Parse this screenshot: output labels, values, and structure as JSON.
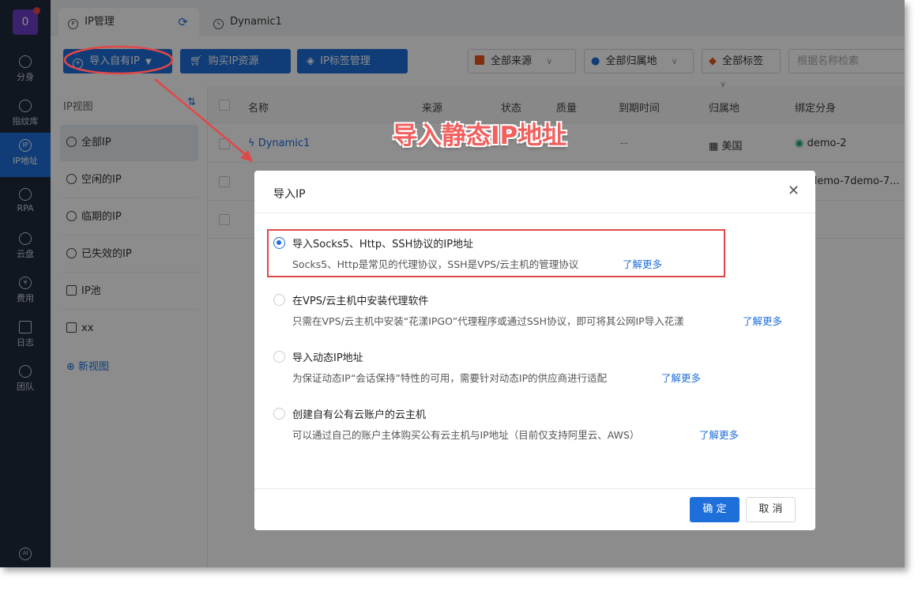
{
  "rail": {
    "avatar": "0",
    "items": [
      {
        "icon": "globe-icon",
        "label": "分身"
      },
      {
        "icon": "fingerprint-icon",
        "label": "指纹库"
      },
      {
        "icon": "ip-icon",
        "label": "IP地址"
      },
      {
        "icon": "robot-icon",
        "label": "RPA"
      },
      {
        "icon": "cloud-disk-icon",
        "label": "云盘"
      },
      {
        "icon": "yen-icon",
        "label": "费用"
      },
      {
        "icon": "log-icon",
        "label": "日志"
      },
      {
        "icon": "team-icon",
        "label": "团队"
      }
    ],
    "ai_label": "AI"
  },
  "tabs": [
    {
      "label": "IP管理"
    },
    {
      "label": "Dynamic1"
    }
  ],
  "toolbar": {
    "import_label": "导入自有IP",
    "buy_label": "购买IP资源",
    "tag_manage_label": "IP标签管理",
    "filters": [
      "全部来源",
      "全部归属地",
      "全部标签"
    ],
    "search_placeholder": "根据名称检索"
  },
  "sidenav": {
    "header": "IP视图",
    "items": [
      "全部IP",
      "空闲的IP",
      "临期的IP",
      "已失效的IP",
      "IP池",
      "xx"
    ],
    "new_view": "新视图"
  },
  "table": {
    "columns": [
      "名称",
      "来源",
      "状态",
      "质量",
      "到期时间",
      "归属地",
      "绑定分身"
    ],
    "rows": [
      {
        "name": "Dynamic1",
        "expire": "--",
        "location": "美国",
        "bound": "demo-2"
      },
      {
        "name": "",
        "expire": "",
        "location": "",
        "bound": "demo-7demo-7..."
      },
      {
        "name": "",
        "expire": "",
        "location": "",
        "bound": ""
      }
    ]
  },
  "modal": {
    "title": "导入IP",
    "options": [
      {
        "title": "导入Socks5、Http、SSH协议的IP地址",
        "desc": "Socks5、Http是常见的代理协议，SSH是VPS/云主机的管理协议",
        "learn": "了解更多",
        "selected": true
      },
      {
        "title": "在VPS/云主机中安装代理软件",
        "desc": "只需在VPS/云主机中安装“花漾IPGO”代理程序或通过SSH协议，即可将其公网IP导入花漾",
        "learn": "了解更多",
        "selected": false
      },
      {
        "title": "导入动态IP地址",
        "desc": "为保证动态IP“会话保持”特性的可用，需要针对动态IP的供应商进行适配",
        "learn": "了解更多",
        "selected": false
      },
      {
        "title": "创建自有公有云账户的云主机",
        "desc": "可以通过自己的账户主体购买公有云主机与IP地址（目前仅支持阿里云、AWS）",
        "learn": "了解更多",
        "selected": false
      }
    ],
    "ok_label": "确 定",
    "cancel_label": "取 消"
  },
  "annotation": {
    "callout": "导入静态IP地址",
    "color": "#e04848"
  },
  "colors": {
    "primary": "#1e6fd9",
    "rail": "#1f2a3d"
  }
}
